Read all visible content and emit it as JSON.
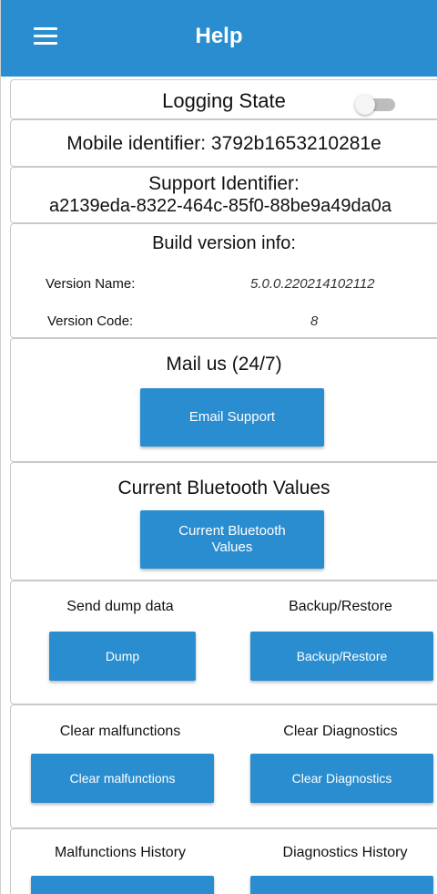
{
  "appbar": {
    "title": "Help",
    "menu_icon": "hamburger-menu-icon"
  },
  "logging": {
    "label": "Logging State",
    "toggle_on": false
  },
  "mobile_identifier": {
    "text": "Mobile identifier: 3792b1653210281e"
  },
  "support_identifier": {
    "label": "Support Identifier:",
    "value": "a2139eda-8322-464c-85f0-88be9a49da0a"
  },
  "build": {
    "title": "Build version info:",
    "version_name_label": "Version Name:",
    "version_name_value": "5.0.0.220214102112",
    "version_code_label": "Version Code:",
    "version_code_value": "8"
  },
  "mail": {
    "title": "Mail us (24/7)",
    "button": "Email Support"
  },
  "bluetooth": {
    "title": "Current Bluetooth Values",
    "button_line1": "Current Bluetooth",
    "button_line2": "Values"
  },
  "dump_backup": {
    "left_title": "Send dump data",
    "left_button": "Dump",
    "right_title": "Backup/Restore",
    "right_button": "Backup/Restore"
  },
  "clear": {
    "left_title": "Clear malfunctions",
    "left_button": "Clear malfunctions",
    "right_title": "Clear Diagnostics",
    "right_button": "Clear Diagnostics"
  },
  "history": {
    "left_title": "Malfunctions History",
    "right_title": "Diagnostics History"
  },
  "colors": {
    "primary": "#2a8dd0",
    "toggle_off": "#bdbdbd"
  }
}
